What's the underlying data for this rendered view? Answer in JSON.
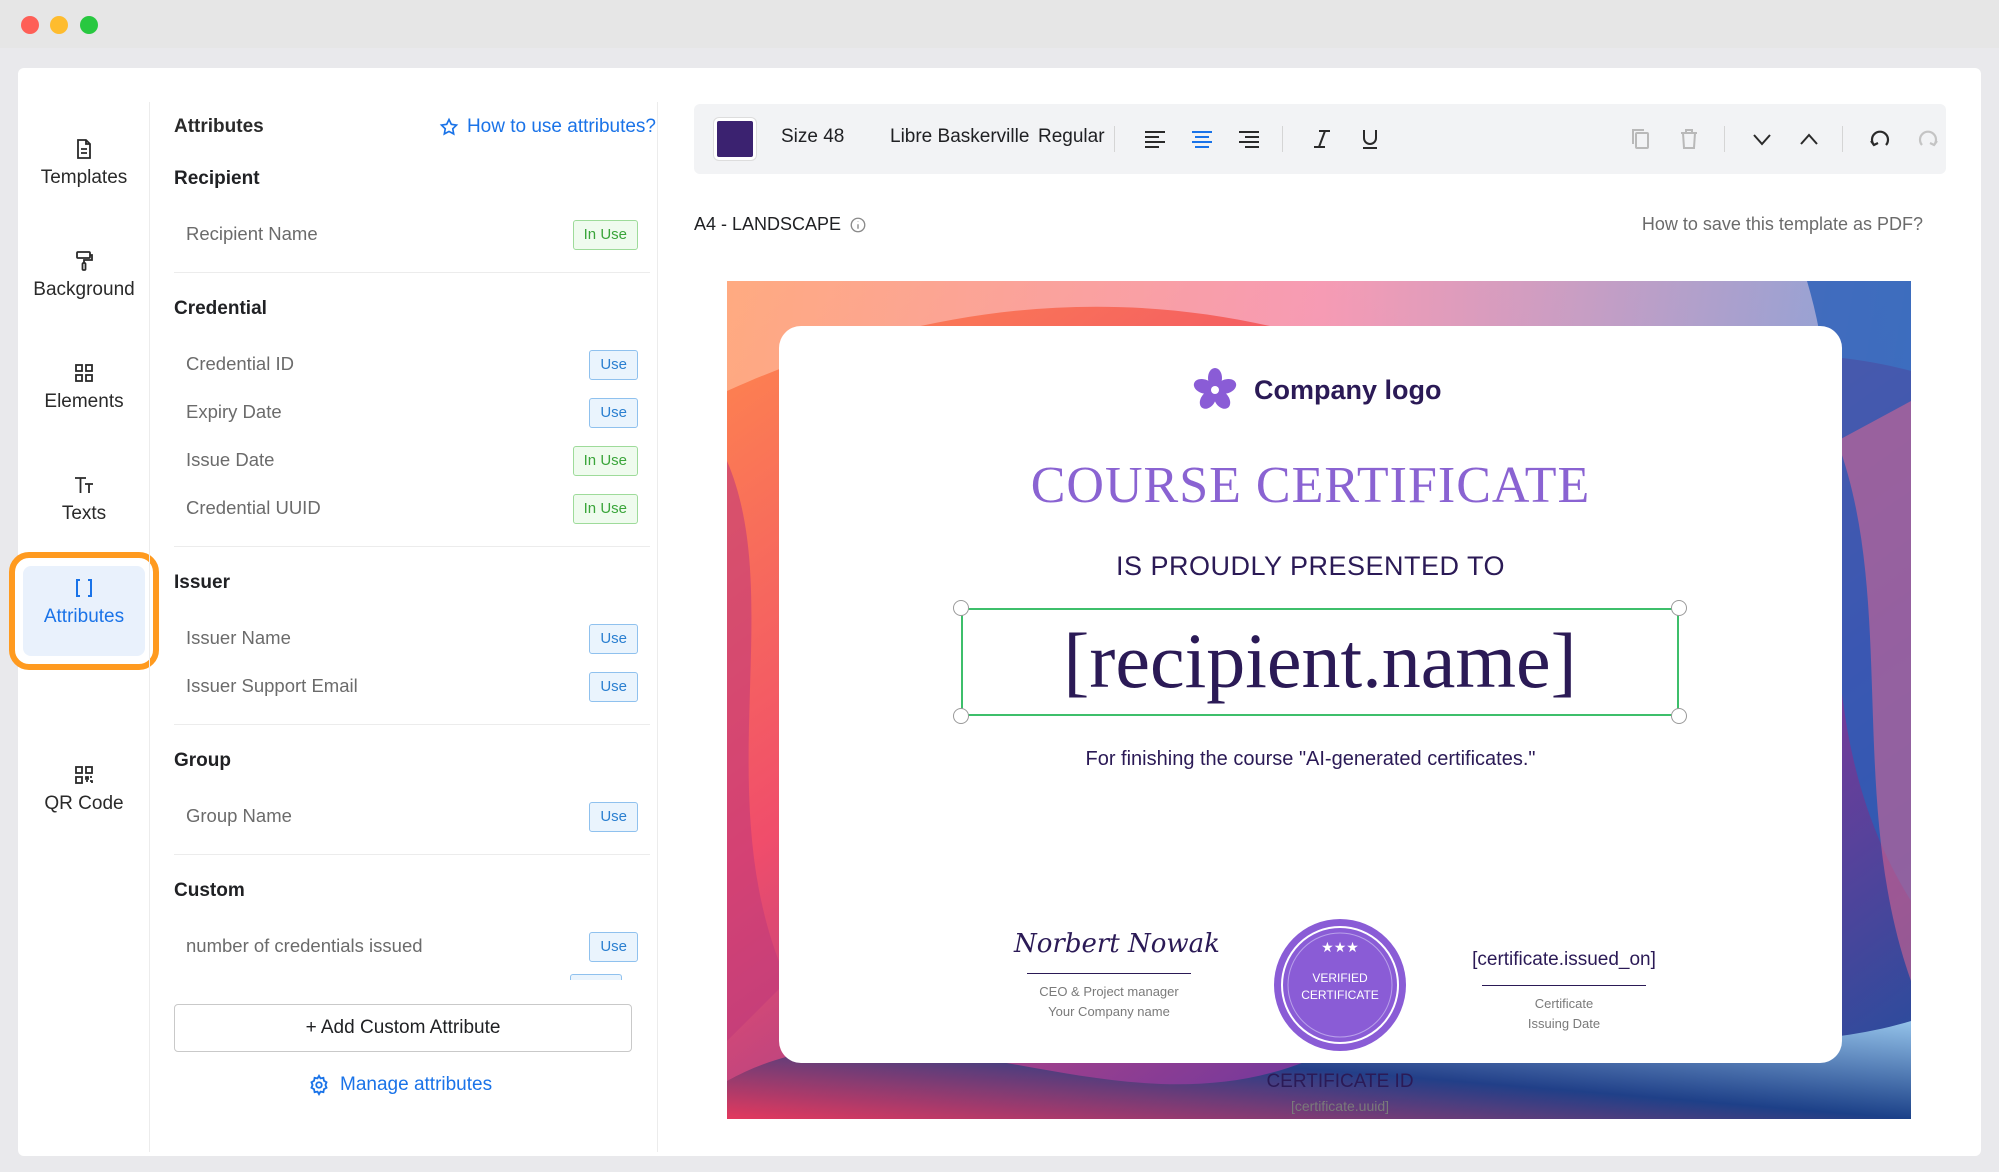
{
  "window": {
    "controls": [
      "close",
      "minimize",
      "maximize"
    ]
  },
  "rail": {
    "items": [
      {
        "label": "Templates",
        "icon": "file-icon"
      },
      {
        "label": "Background",
        "icon": "paint-roller-icon"
      },
      {
        "label": "Elements",
        "icon": "grid-elements-icon"
      },
      {
        "label": "Texts",
        "icon": "text-icon"
      },
      {
        "label": "Attributes",
        "icon": "brackets-icon",
        "active": true
      },
      {
        "label": "QR Code",
        "icon": "qr-code-icon"
      }
    ]
  },
  "panel": {
    "title": "Attributes",
    "help_link": "How to use attributes?",
    "groups": [
      {
        "title": "Recipient",
        "items": [
          {
            "label": "Recipient Name",
            "status": "In Use"
          }
        ]
      },
      {
        "title": "Credential",
        "items": [
          {
            "label": "Credential ID",
            "status": "Use"
          },
          {
            "label": "Expiry Date",
            "status": "Use"
          },
          {
            "label": "Issue Date",
            "status": "In Use"
          },
          {
            "label": "Credential UUID",
            "status": "In Use"
          }
        ]
      },
      {
        "title": "Issuer",
        "items": [
          {
            "label": "Issuer Name",
            "status": "Use"
          },
          {
            "label": "Issuer Support Email",
            "status": "Use"
          }
        ]
      },
      {
        "title": "Group",
        "items": [
          {
            "label": "Group Name",
            "status": "Use"
          }
        ]
      },
      {
        "title": "Custom",
        "items": [
          {
            "label": "number of credentials issued",
            "status": "Use"
          }
        ]
      }
    ],
    "add_button": "+ Add Custom Attribute",
    "manage_link": "Manage attributes"
  },
  "toolbar": {
    "color": "#3b2270",
    "size": "Size 48",
    "font": "Libre Baskerville",
    "weight": "Regular",
    "active_align": "center"
  },
  "canvas": {
    "page_size": "A4 - LANDSCAPE",
    "save_pdf_link": "How to save this template as PDF?"
  },
  "certificate": {
    "logo_text": "Company logo",
    "title": "COURSE CERTIFICATE",
    "subtitle": "IS PROUDLY PRESENTED TO",
    "recipient": "[recipient.name]",
    "description": "For finishing the course \"AI-generated certificates.\"",
    "signature_name": "Norbert Nowak",
    "signature_role": "CEO & Project manager",
    "signature_company": "Your Company name",
    "seal_line1": "VERIFIED",
    "seal_line2": "CERTIFICATE",
    "seal_stars": "★★★",
    "date_value": "[certificate.issued_on]",
    "date_caption_1": "Certificate",
    "date_caption_2": "Issuing Date",
    "id_label": "CERTIFICATE ID",
    "id_value": "[certificate.uuid]",
    "accent": "#8a63d2",
    "ink": "#2b1a56"
  }
}
